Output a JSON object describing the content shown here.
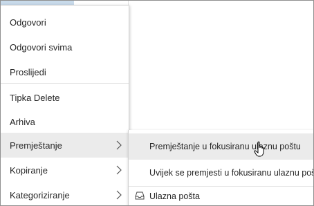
{
  "context_menu": {
    "items": [
      {
        "label": "Odgovori"
      },
      {
        "label": "Odgovori svima"
      },
      {
        "label": "Proslijedi"
      },
      {
        "label": "Tipka Delete"
      },
      {
        "label": "Arhiva"
      },
      {
        "label": "Premještanje",
        "has_submenu": true,
        "active": true
      },
      {
        "label": "Kopiranje",
        "has_submenu": true
      },
      {
        "label": "Kategoriziranje",
        "has_submenu": true
      }
    ]
  },
  "submenu": {
    "items": [
      {
        "label": "Premještanje u fokusiranu ulaznu poštu",
        "active": true
      },
      {
        "label": "Uvijek se premjesti u fokusiranu ulaznu poštu"
      },
      {
        "label": "Ulazna pošta",
        "icon": "inbox-icon"
      }
    ]
  },
  "colors": {
    "hover_background": "#ebebeb",
    "text": "#262626",
    "separator": "#e1e1e1",
    "selection_strip": "#c8daea"
  }
}
